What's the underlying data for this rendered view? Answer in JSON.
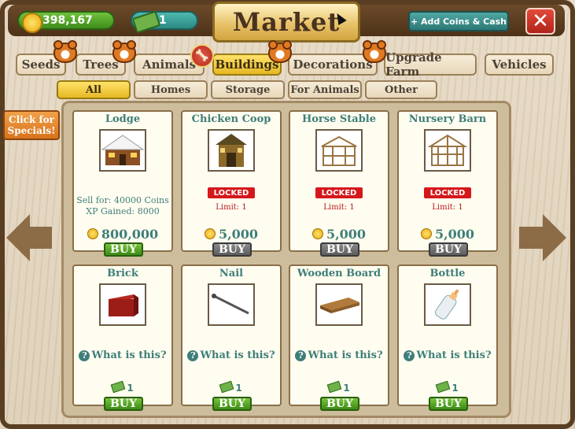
{
  "header": {
    "coins": "398,167",
    "cash": "1",
    "title": "Market",
    "add_button": "+ Add Coins & Cash",
    "close": "✕"
  },
  "tabs": [
    "Seeds",
    "Trees",
    "Animals",
    "Buildings",
    "Decorations",
    "Upgrade Farm",
    "Vehicles"
  ],
  "active_tab": "Buildings",
  "subtabs": [
    "All",
    "Homes",
    "Storage",
    "For Animals",
    "Other"
  ],
  "active_subtab": "All",
  "specials": "Click for Specials!",
  "row1": [
    {
      "title": "Lodge",
      "icon": "lodge-icon",
      "sell": "Sell for: 40000 Coins",
      "xp": "XP Gained: 8000",
      "price": "800,000",
      "buy": "BUY",
      "locked": false
    },
    {
      "title": "Chicken Coop",
      "icon": "chicken-coop-icon",
      "locked_label": "LOCKED",
      "limit": "Limit: 1",
      "price": "5,000",
      "buy": "BUY",
      "locked": true
    },
    {
      "title": "Horse Stable",
      "icon": "horse-stable-icon",
      "locked_label": "LOCKED",
      "limit": "Limit: 1",
      "price": "5,000",
      "buy": "BUY",
      "locked": true
    },
    {
      "title": "Nursery Barn",
      "icon": "nursery-barn-icon",
      "locked_label": "LOCKED",
      "limit": "Limit: 1",
      "price": "5,000",
      "buy": "BUY",
      "locked": true
    }
  ],
  "row2": [
    {
      "title": "Brick",
      "icon": "brick-icon",
      "what": "What is this?",
      "price": "1",
      "buy": "BUY"
    },
    {
      "title": "Nail",
      "icon": "nail-icon",
      "what": "What is this?",
      "price": "1",
      "buy": "BUY"
    },
    {
      "title": "Wooden Board",
      "icon": "wooden-board-icon",
      "what": "What is this?",
      "price": "1",
      "buy": "BUY"
    },
    {
      "title": "Bottle",
      "icon": "bottle-icon",
      "what": "What is this?",
      "price": "1",
      "buy": "BUY"
    }
  ],
  "colors": {
    "accent": "#3f7e79",
    "locked": "#d5171b",
    "buy": "#4a9a1f"
  }
}
